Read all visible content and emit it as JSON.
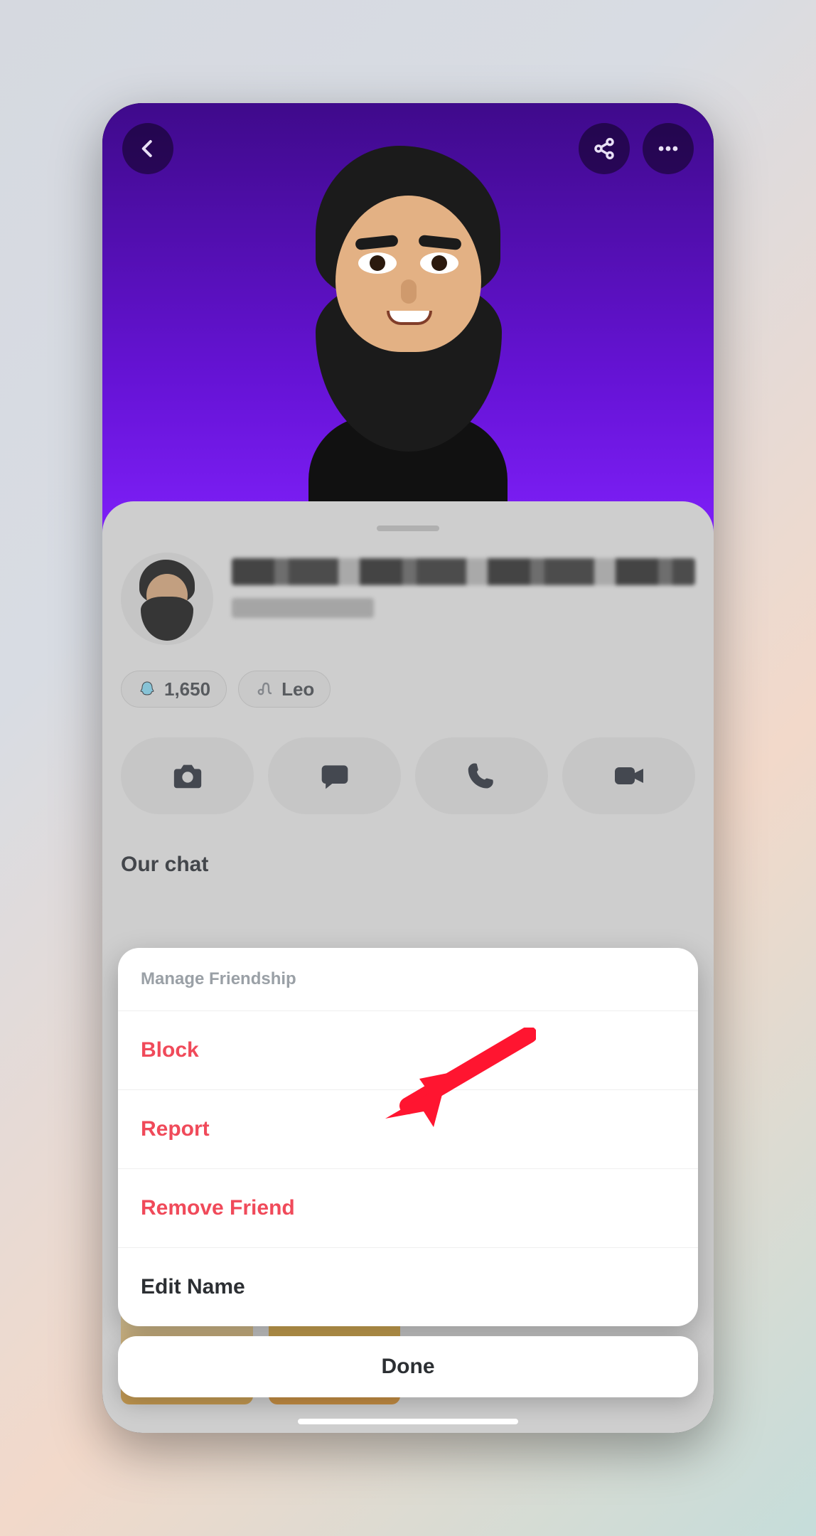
{
  "profile": {
    "score": "1,650",
    "zodiac": "Leo"
  },
  "section": {
    "our_chat": "Our chat"
  },
  "action_sheet": {
    "title": "Manage Friendship",
    "block": "Block",
    "report": "Report",
    "remove": "Remove Friend",
    "edit": "Edit Name",
    "done": "Done"
  },
  "annotation": {
    "arrow_target": "remove-friend-item"
  }
}
